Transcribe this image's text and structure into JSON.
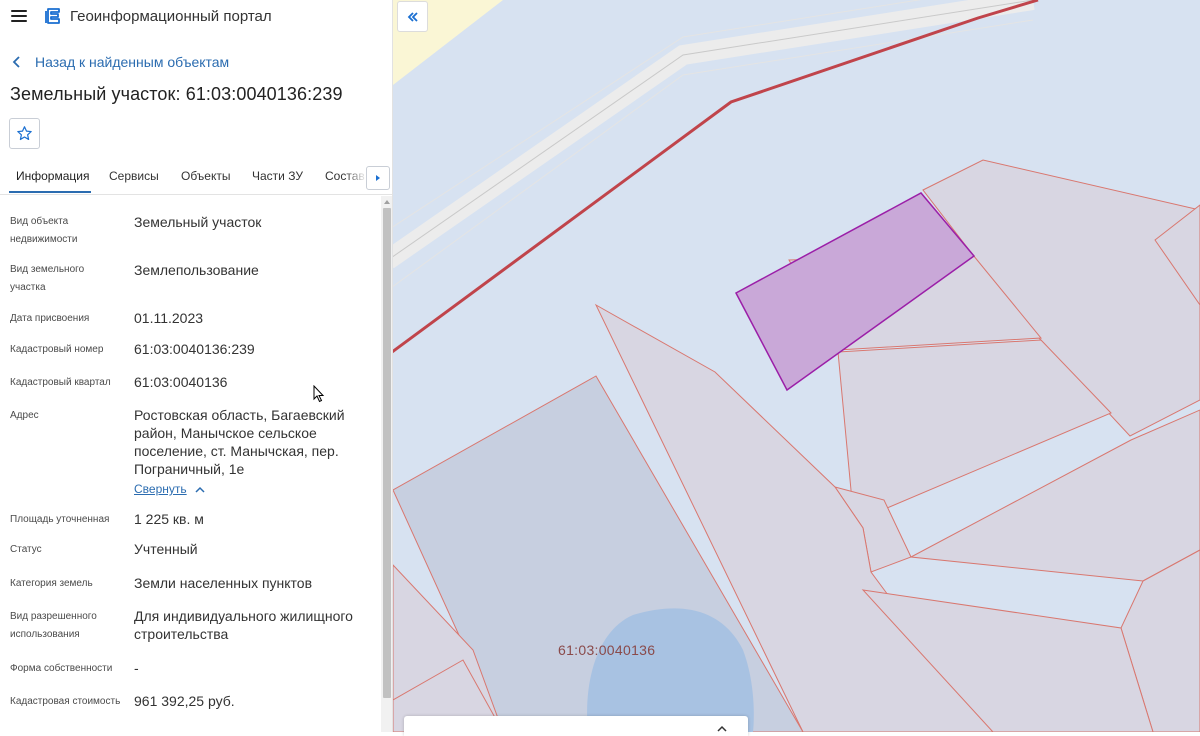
{
  "app": {
    "title": "Геоинформационный портал"
  },
  "nav": {
    "back_label": "Назад к найденным объектам"
  },
  "page": {
    "title": "Земельный участок: 61:03:0040136:239"
  },
  "tabs": [
    {
      "label": "Информация",
      "active": true
    },
    {
      "label": "Сервисы"
    },
    {
      "label": "Объекты"
    },
    {
      "label": "Части ЗУ"
    },
    {
      "label": "Состав"
    }
  ],
  "info": {
    "object_type": {
      "label": "Вид объекта недвижимости",
      "value": "Земельный участок"
    },
    "land_type": {
      "label": "Вид земельного участка",
      "value": "Землепользование"
    },
    "assigned_date": {
      "label": "Дата присвоения",
      "value": "01.11.2023"
    },
    "cadastral_number": {
      "label": "Кадастровый номер",
      "value": "61:03:0040136:239"
    },
    "cadastral_quarter": {
      "label": "Кадастровый квартал",
      "value": "61:03:0040136"
    },
    "address": {
      "label": "Адрес",
      "value": "Ростовская область, Багаевский район, Манычское сельское поселение, ст. Манычская, пер. Пограничный, 1е",
      "collapse_label": "Свернуть"
    },
    "area": {
      "label": "Площадь уточненная",
      "value": "1 225 кв. м"
    },
    "status": {
      "label": "Статус",
      "value": "Учтенный"
    },
    "land_category": {
      "label": "Категория земель",
      "value": "Земли населенных пунктов"
    },
    "permitted_use": {
      "label": "Вид разрешенного использования",
      "value": "Для индивидуального жилищного строительства"
    },
    "ownership": {
      "label": "Форма собственности",
      "value": "-"
    },
    "cadastral_value": {
      "label": "Кадастровая стоимость",
      "value": "961 392,25 руб."
    }
  },
  "map": {
    "quarter_label": "61:03:0040136"
  },
  "colors": {
    "accent": "#2b6cb0",
    "selected_parcel": "#9b1fa8",
    "parcel_border": "#d9776f",
    "road_line": "#c0444b"
  }
}
